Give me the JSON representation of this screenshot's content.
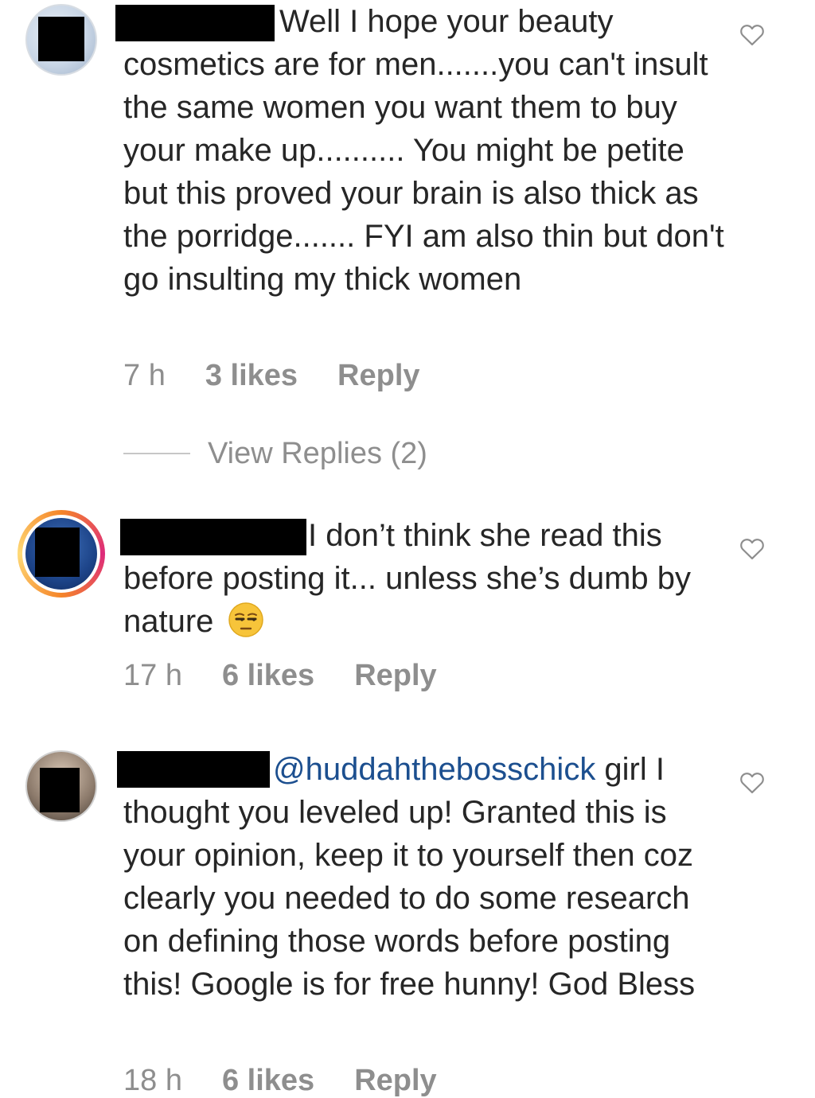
{
  "comments": [
    {
      "text": "Well I hope your beauty cosmetics are for men.......you can't insult the same women you want them to buy your make up.......... You might be petite but this proved your brain is also thick as the porridge....... FYI am also thin but don't go insulting my thick women",
      "time": "7 h",
      "likes": "3 likes",
      "reply": "Reply",
      "view_replies": "View Replies (2)"
    },
    {
      "text": "I don’t think she read this before posting it... unless she’s dumb by nature",
      "emoji": "unamused-face-icon",
      "time": "17 h",
      "likes": "6 likes",
      "reply": "Reply"
    },
    {
      "mention": "@huddahthebosschick",
      "text": " girl I thought you leveled up! Granted this is your opinion, keep it to yourself then coz clearly you needed to do some research on defining those words before posting this! Google is for free hunny! God Bless",
      "time": "18 h",
      "likes": "6 likes",
      "reply": "Reply"
    }
  ],
  "colors": {
    "text": "#262626",
    "meta": "#8e8e8e",
    "mention": "#1c4f8f",
    "redaction": "#000000"
  },
  "icons": {
    "like": "heart-outline-icon"
  }
}
